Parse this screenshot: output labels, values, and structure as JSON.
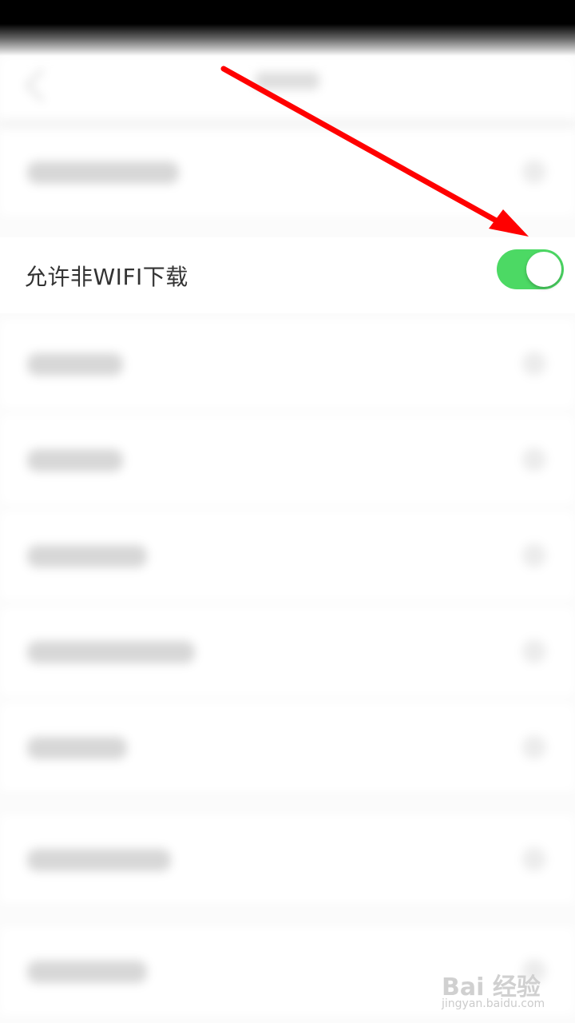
{
  "setting": {
    "label": "允许非WIFI下载",
    "enabled": true
  },
  "colors": {
    "toggle_on": "#4cd964",
    "arrow": "#ff0000"
  },
  "watermark": {
    "brand": "Bai 经验",
    "url": "jingyan.baidu.com"
  }
}
